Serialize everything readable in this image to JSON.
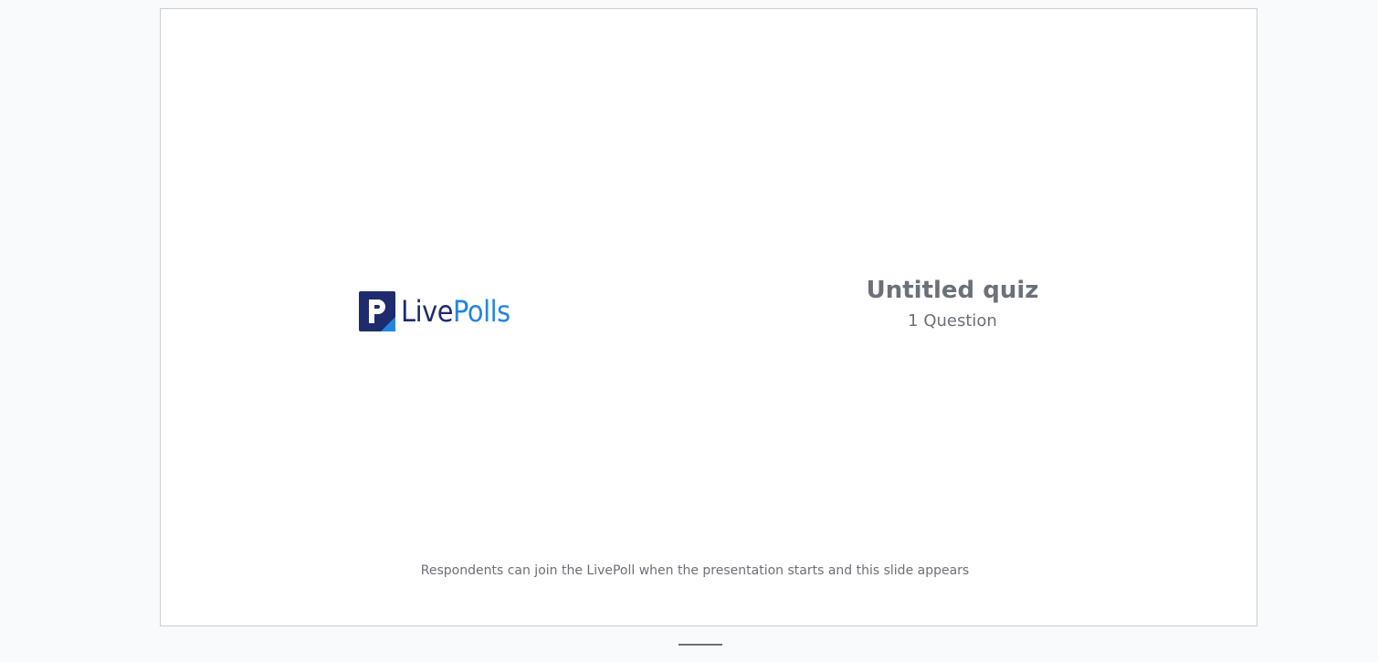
{
  "slide": {
    "logo": {
      "text_live": "Live",
      "text_polls": "Polls",
      "icon": "livepolls-logo-icon",
      "colors": {
        "dark": "#1e2c6e",
        "light": "#2486db"
      }
    },
    "quiz_title": "Untitled quiz",
    "question_count": "1 Question",
    "join_note": "Respondents can join the LivePoll when the presentation starts and this slide appears"
  },
  "slide_indicator": {
    "icon": "slide-indicator-bar"
  },
  "colors": {
    "background": "#f9fafc",
    "slide_border": "#c9cdd3",
    "text_muted": "#6b7079"
  }
}
